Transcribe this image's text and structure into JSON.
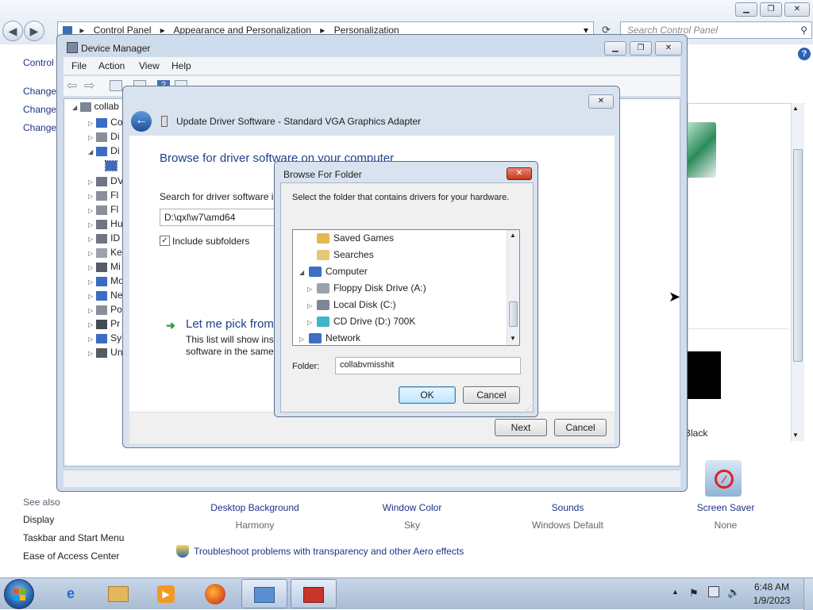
{
  "control_panel": {
    "breadcrumb": [
      "Control Panel",
      "Appearance and Personalization",
      "Personalization"
    ],
    "search_placeholder": "Search Control Panel",
    "left_title": "Control",
    "left_links": [
      "Change",
      "Change",
      "Change"
    ],
    "see_also_heading": "See also",
    "see_also_links": [
      "Display",
      "Taskbar and Start Menu",
      "Ease of Access Center"
    ],
    "personalization_items": [
      {
        "title": "Desktop Background",
        "subtitle": "Harmony"
      },
      {
        "title": "Window Color",
        "subtitle": "Sky"
      },
      {
        "title": "Sounds",
        "subtitle": "Windows Default"
      },
      {
        "title": "Screen Saver",
        "subtitle": "None"
      }
    ],
    "troubleshoot_link": "Troubleshoot problems with transparency and other Aero effects",
    "theme_caption": "Black"
  },
  "device_manager": {
    "title": "Device Manager",
    "menu": [
      "File",
      "Action",
      "View",
      "Help"
    ],
    "tree_root": "collab",
    "tree_items": [
      "Co",
      "Di",
      "Di",
      "DV",
      "Fl",
      "Fl",
      "Hu",
      "ID",
      "Ke",
      "Mi",
      "Mo",
      "Ne",
      "Po",
      "Pr",
      "Sy",
      "Un"
    ]
  },
  "update_driver": {
    "title": "Update Driver Software - Standard VGA Graphics Adapter",
    "heading": "Browse for driver software on your computer",
    "search_label": "Search for driver software in",
    "path_value": "D:\\qxl\\w7\\amd64",
    "include_subfolders_label": "Include subfolders",
    "pick_title": "Let me pick from",
    "pick_desc_line1": "This list will show inst",
    "pick_desc_line2": "software in the same",
    "next_label": "Next",
    "cancel_label": "Cancel"
  },
  "browse_folder": {
    "title": "Browse For Folder",
    "instruction": "Select the folder that contains drivers for your hardware.",
    "tree": [
      {
        "label": "Saved Games",
        "level": 2
      },
      {
        "label": "Searches",
        "level": 2
      },
      {
        "label": "Computer",
        "level": 1
      },
      {
        "label": "Floppy Disk Drive (A:)",
        "level": 2
      },
      {
        "label": "Local Disk (C:)",
        "level": 2
      },
      {
        "label": "CD Drive (D:) 700K",
        "level": 2
      },
      {
        "label": "Network",
        "level": 1
      }
    ],
    "folder_label": "Folder:",
    "folder_value": "collabvmisshit",
    "ok_label": "OK",
    "cancel_label": "Cancel"
  },
  "taskbar": {
    "time": "6:48 AM",
    "date": "1/9/2023"
  }
}
